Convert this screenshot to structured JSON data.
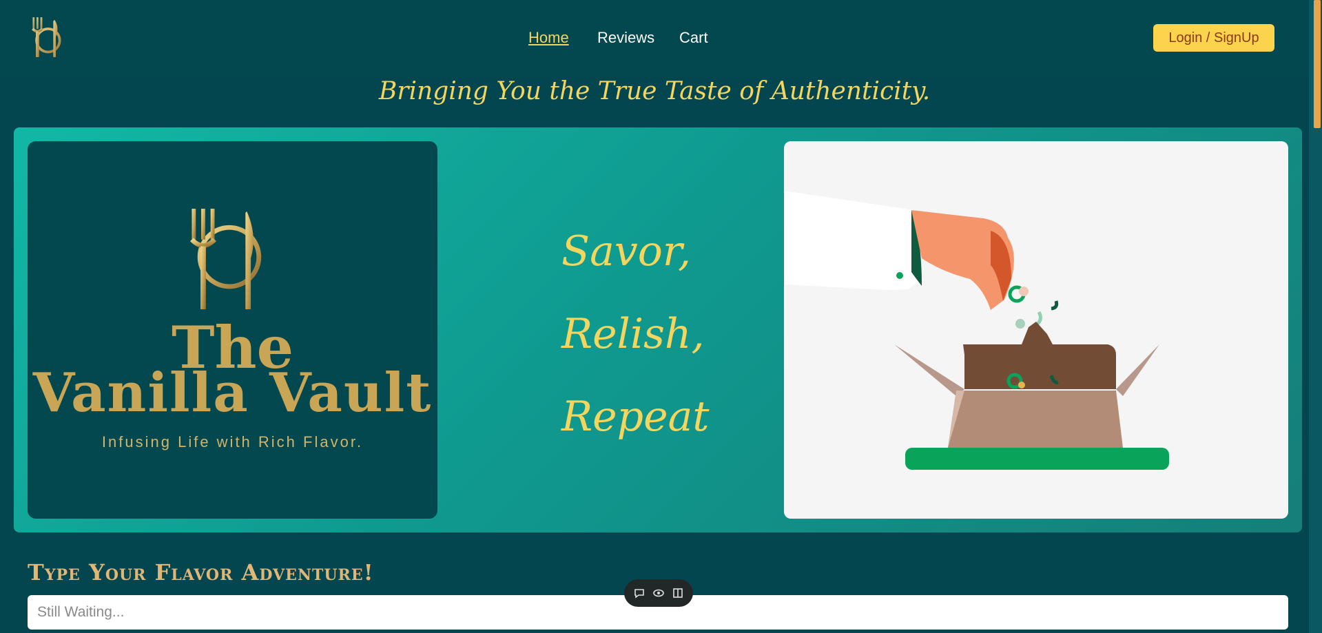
{
  "header": {
    "logo_icon": "fork-plate-icon",
    "nav": [
      {
        "label": "Home",
        "active": true
      },
      {
        "label": "Reviews",
        "active": false
      },
      {
        "label": "Cart",
        "active": false
      }
    ],
    "login_label": "Login / SignUp"
  },
  "tagline": "Bringing You the True Taste of Authenticity.",
  "hero": {
    "brand": {
      "line1": "The",
      "line2": "Vanilla Vault",
      "subtitle": "Infusing Life with Rich Flavor."
    },
    "words": [
      "Savor,",
      "Relish,",
      "Repeat"
    ]
  },
  "search": {
    "title": "Type Your Flavor Adventure!",
    "placeholder": "Still Waiting..."
  },
  "toolbar": {
    "icons": [
      "comment-icon",
      "eye-icon",
      "book-icon"
    ]
  },
  "colors": {
    "background": "#034650",
    "accent_gold": "#f4d65e",
    "button_yellow": "#fcd34d",
    "hero_teal": "#13b7a5",
    "scroll_thumb": "#e8a34d"
  }
}
